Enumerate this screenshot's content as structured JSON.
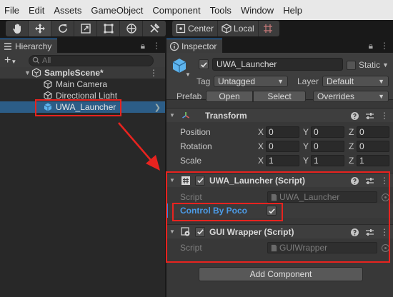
{
  "menubar": {
    "items": [
      "File",
      "Edit",
      "Assets",
      "GameObject",
      "Component",
      "Tools",
      "Window",
      "Help"
    ]
  },
  "toolbar": {
    "tools": [
      "hand-icon",
      "move-icon",
      "rotate-icon",
      "scale-icon",
      "rect-tool-icon",
      "transform-tool-icon",
      "custom-tool-icon"
    ],
    "pivot_mode": "Center",
    "pivot_rotation": "Local"
  },
  "hierarchy": {
    "tab_label": "Hierarchy",
    "add_label": "+",
    "search_placeholder": "All",
    "scene_name": "SampleScene*",
    "children": [
      "Main Camera",
      "Directional Light",
      "UWA_Launcher"
    ],
    "selected": "UWA_Launcher"
  },
  "inspector": {
    "tab_label": "Inspector",
    "object_name": "UWA_Launcher",
    "active": true,
    "static_label": "Static",
    "tag_label": "Tag",
    "tag_value": "Untagged",
    "layer_label": "Layer",
    "layer_value": "Default",
    "prefab_label": "Prefab",
    "prefab_open": "Open",
    "prefab_select": "Select",
    "prefab_overrides": "Overrides",
    "transform": {
      "title": "Transform",
      "position_label": "Position",
      "rotation_label": "Rotation",
      "scale_label": "Scale",
      "axis_x": "X",
      "axis_y": "Y",
      "axis_z": "Z",
      "position": [
        "0",
        "0",
        "0"
      ],
      "rotation": [
        "0",
        "0",
        "0"
      ],
      "scale": [
        "1",
        "1",
        "1"
      ]
    },
    "launcher_script": {
      "title": "UWA_Launcher (Script)",
      "script_label": "Script",
      "script_value": "UWA_Launcher",
      "control_by_poco_label": "Control By Poco",
      "control_by_poco": true
    },
    "gui_wrapper": {
      "title": "GUI Wrapper (Script)",
      "script_label": "Script",
      "script_value": "GUIWrapper"
    },
    "add_component_label": "Add Component"
  },
  "colors": {
    "highlight_red": "#e8231f",
    "selection_blue": "#2c5d87",
    "label_blue": "#4c9ce8"
  }
}
